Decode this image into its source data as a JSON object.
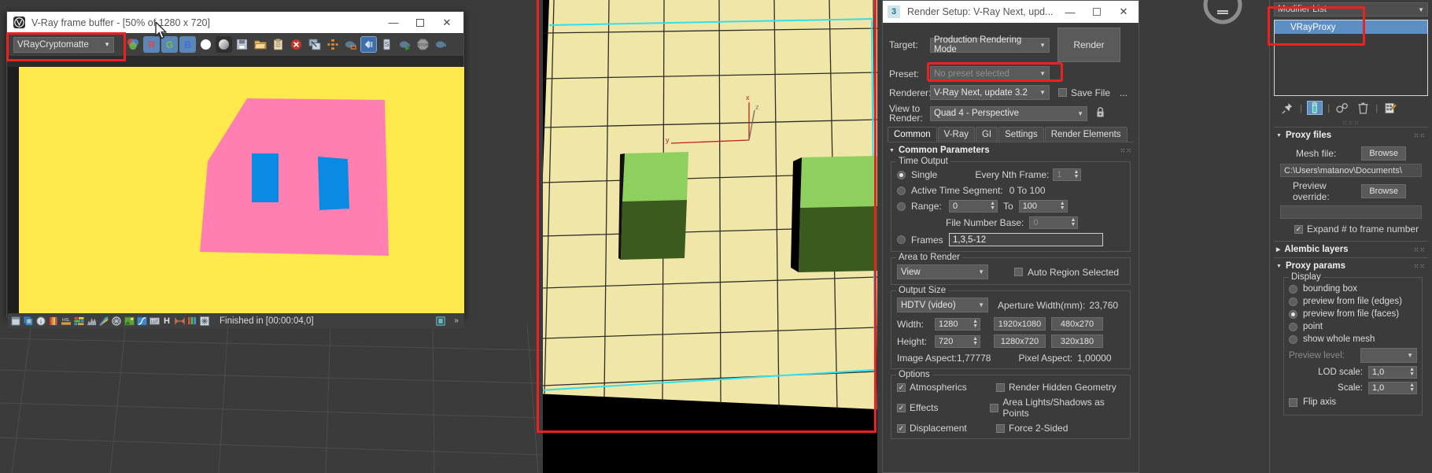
{
  "vfb": {
    "title": "V-Ray frame buffer - [50% of 1280 x 720]",
    "logo_icon": "vray-logo-icon",
    "minimize": "—",
    "maximize": "☐",
    "close": "✕",
    "channel_select": {
      "value": "VRayCryptomatte",
      "arrow": "▼"
    },
    "toolbar_icons": [
      "rgb-color-icon",
      "red-channel-icon",
      "green-channel-icon",
      "blue-channel-icon",
      "alpha-white-icon",
      "alpha-grey-icon",
      "save-image-icon",
      "open-image-icon",
      "copy-clipboard-icon",
      "clear-image-icon",
      "duplicate-window-icon",
      "region-render-icon",
      "teapot-render-icon",
      "stereo-icon",
      "script-icon",
      "teapot-play-icon",
      "stop-icon",
      "teapot-last-icon"
    ],
    "toolbar_labels": {
      "r": "R",
      "g": "G",
      "b": "B",
      "stop": "STOP",
      "lut": "LUT",
      "h": "H"
    },
    "status_icons": [
      "layers-icon",
      "color-corrections-icon",
      "info-icon",
      "exposure-icon",
      "hsl-icon",
      "color-balance-icon",
      "curve-icon",
      "lut-rainbow-icon",
      "white-balance-icon",
      "background-icon",
      "filmic-curve-icon",
      "lut-tag-icon",
      "hue-icon",
      "level-icon",
      "rgb-bars-icon",
      "denoise-icon"
    ],
    "status_text": "Finished in [00:00:04,0]",
    "status_right_icons": [
      "panel-toggle-icon",
      "chevron-double-down-icon"
    ],
    "render_image": {
      "background_color": "#ffe94d",
      "plane_color": "#ff80b0",
      "box1_color": "#0b8ae3",
      "box2_color": "#0b8ae3"
    }
  },
  "viewport": {
    "floor_color": "#f0e6a8",
    "grid_color": "#1a1a1a",
    "box_top_color": "#8ed05e",
    "box_front_color": "#3b5b1e",
    "box_side_color": "#000000",
    "gizmo_axes": [
      "x",
      "y",
      "z"
    ],
    "selection_border_color": "#30e0ea"
  },
  "render_setup": {
    "logo_icon": "max-logo-icon",
    "title": "Render Setup: V-Ray Next, upd...",
    "minimize": "—",
    "maximize": "☐",
    "close": "✕",
    "target": {
      "label": "Target:",
      "value": "Production Rendering Mode",
      "arrow": "▼"
    },
    "preset": {
      "label": "Preset:",
      "value": "No preset selected",
      "arrow": "▼"
    },
    "renderer": {
      "label": "Renderer:",
      "value": "V-Ray Next, update 3.2",
      "arrow": "▼"
    },
    "view_to_render": {
      "label": "View to\nRender:",
      "label_l1": "View to",
      "label_l2": "Render:",
      "value": "Quad 4 - Perspective",
      "arrow": "▼"
    },
    "render_button": "Render",
    "save_file": {
      "label": "Save File",
      "checked": false
    },
    "ellipsis_button": "...",
    "lock_icon": "lock-icon",
    "tabs": [
      {
        "label": "Common",
        "active": true
      },
      {
        "label": "V-Ray",
        "active": false
      },
      {
        "label": "GI",
        "active": false
      },
      {
        "label": "Settings",
        "active": false
      },
      {
        "label": "Render Elements",
        "active": false
      }
    ],
    "rollout": {
      "title": "Common Parameters",
      "expand_arrow": "▼",
      "grip_icon": "rollout-grip-icon"
    },
    "time_output": {
      "title": "Time Output",
      "single": {
        "label": "Single",
        "selected": true
      },
      "every_nth": {
        "label": "Every Nth Frame:",
        "value": "1",
        "disabled": true
      },
      "active_segment": {
        "label": "Active Time Segment:",
        "value": "0 To 100",
        "selected": false
      },
      "range": {
        "label": "Range:",
        "from": "0",
        "to_label": "To",
        "to": "100",
        "selected": false
      },
      "file_number_base": {
        "label": "File Number Base:",
        "value": "0",
        "disabled": true
      },
      "frames": {
        "label": "Frames",
        "value": "1,3,5-12",
        "selected": false
      }
    },
    "area_to_render": {
      "title": "Area to Render",
      "value": "View",
      "arrow": "▼",
      "auto_region": {
        "label": "Auto Region Selected",
        "checked": false
      }
    },
    "output_size": {
      "title": "Output Size",
      "preset": "HDTV (video)",
      "arrow": "▼",
      "aperture_label": "Aperture Width(mm):",
      "aperture_value": "23,760",
      "width_label": "Width:",
      "width_value": "1280",
      "height_label": "Height:",
      "height_value": "720",
      "quick_buttons": [
        "1920x1080",
        "480x270",
        "1280x720",
        "320x180"
      ],
      "image_aspect_label": "Image Aspect:",
      "image_aspect_value": "1,77778",
      "pixel_aspect_label": "Pixel Aspect:",
      "pixel_aspect_value": "1,00000"
    },
    "options": {
      "title": "Options",
      "left": [
        {
          "label": "Atmospherics",
          "checked": true
        },
        {
          "label": "Effects",
          "checked": true
        },
        {
          "label": "Displacement",
          "checked": true
        }
      ],
      "right": [
        {
          "label": "Render Hidden Geometry",
          "checked": false
        },
        {
          "label": "Area Lights/Shadows as Points",
          "checked": false
        },
        {
          "label": "Force 2-Sided",
          "checked": false
        }
      ]
    }
  },
  "command_panel": {
    "modifier_list": {
      "label": "Modifier List",
      "arrow": "▼"
    },
    "stack": [
      {
        "label": "VRayProxy",
        "selected": true
      }
    ],
    "stack_tools": [
      "pin-stack-icon",
      "show-end-result-icon",
      "make-unique-icon",
      "remove-modifier-icon",
      "configure-modifier-sets-icon"
    ],
    "grip": "⁙⁙",
    "proxy_files": {
      "title": "Proxy files",
      "arrow": "▼",
      "mesh_file_label": "Mesh file:",
      "mesh_file_browse": "Browse",
      "mesh_file_value": "C:\\Users\\matanov\\Documents\\",
      "preview_override_label": "Preview override:",
      "preview_override_browse": "Browse",
      "preview_override_value": "",
      "expand_frame": {
        "label": "Expand # to frame number",
        "checked": true
      }
    },
    "alembic_layers": {
      "title": "Alembic layers",
      "arrow": "▶"
    },
    "proxy_params": {
      "title": "Proxy params",
      "arrow": "▼",
      "display_title": "Display",
      "display_options": [
        {
          "label": "bounding box",
          "selected": false
        },
        {
          "label": "preview from file (edges)",
          "selected": false
        },
        {
          "label": "preview from file (faces)",
          "selected": true
        },
        {
          "label": "point",
          "selected": false
        },
        {
          "label": "show whole mesh",
          "selected": false
        }
      ],
      "preview_level": {
        "label": "Preview level:",
        "value": "",
        "arrow": "▼",
        "disabled": true
      },
      "lod_scale": {
        "label": "LOD scale:",
        "value": "1,0"
      },
      "scale": {
        "label": "Scale:",
        "value": "1,0"
      },
      "flip_axis": {
        "label": "Flip axis",
        "checked": false
      }
    }
  },
  "colors": {
    "highlight": "#f02020",
    "accent_blue": "#5d8fc4",
    "panel_bg": "#3b3b3b"
  }
}
